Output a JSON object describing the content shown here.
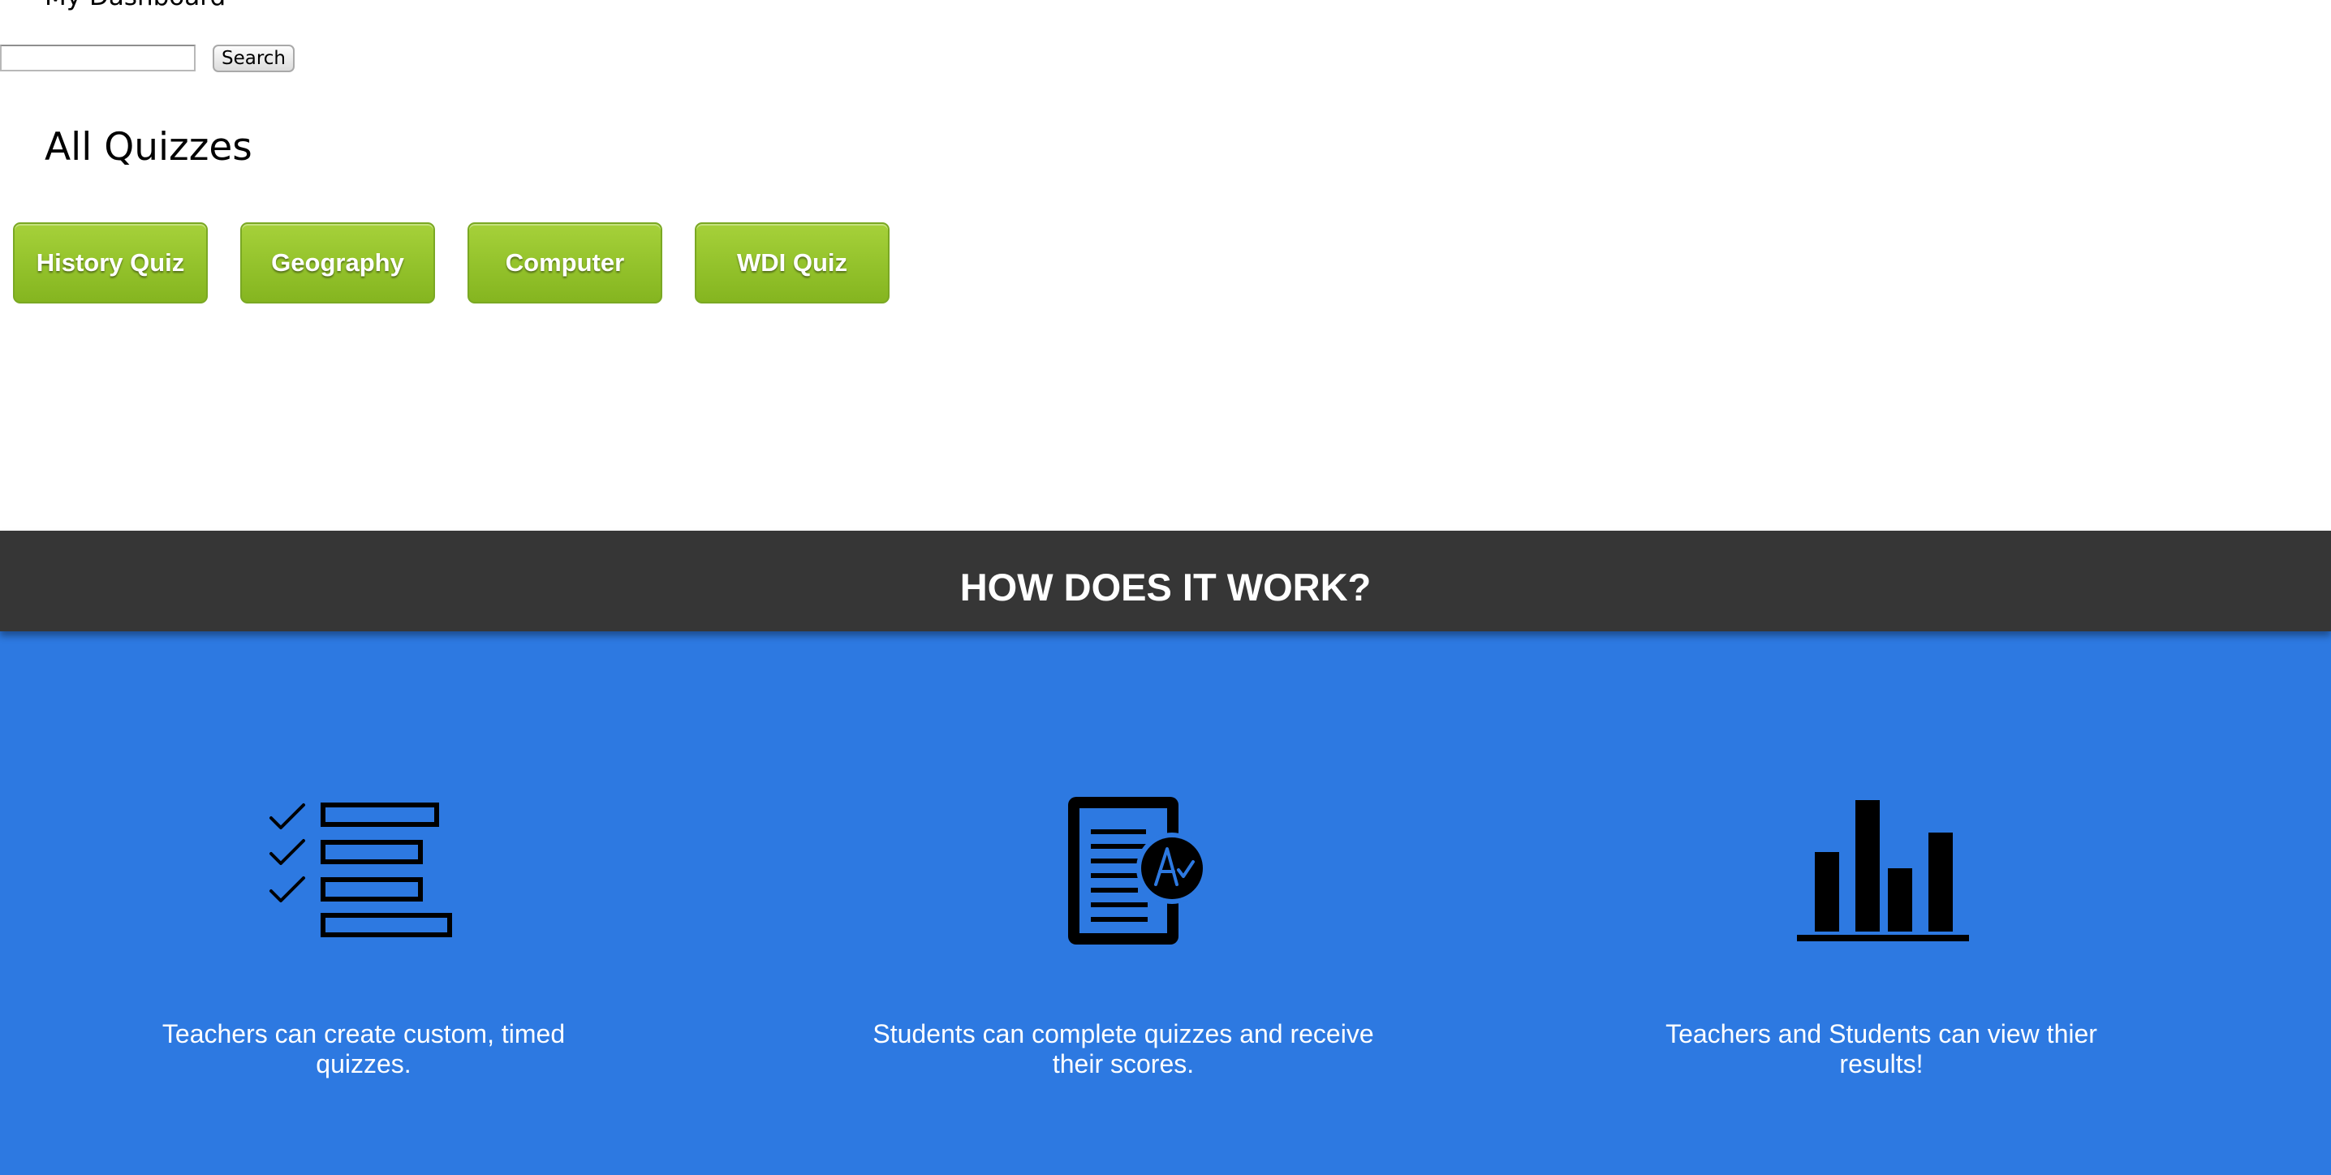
{
  "header": {
    "dashboard_link": "My Dashboard"
  },
  "search": {
    "placeholder": "",
    "value": "",
    "button_label": "Search"
  },
  "quizzes": {
    "title": "All Quizzes",
    "items": [
      {
        "label": "History Quiz"
      },
      {
        "label": "Geography"
      },
      {
        "label": "Computer"
      },
      {
        "label": "WDI Quiz"
      }
    ],
    "button_color": "#93c22b"
  },
  "how_it_works": {
    "title": "HOW DOES IT WORK?",
    "band_color": "#363636",
    "section_color": "#2d79e1",
    "features": [
      {
        "icon": "checklist-icon",
        "text": "Teachers can create custom, timed quizzes."
      },
      {
        "icon": "graded-document-icon",
        "text": "Students can complete quizzes and receive their scores."
      },
      {
        "icon": "bar-chart-icon",
        "text": "Teachers and Students can view thier results!"
      }
    ]
  }
}
